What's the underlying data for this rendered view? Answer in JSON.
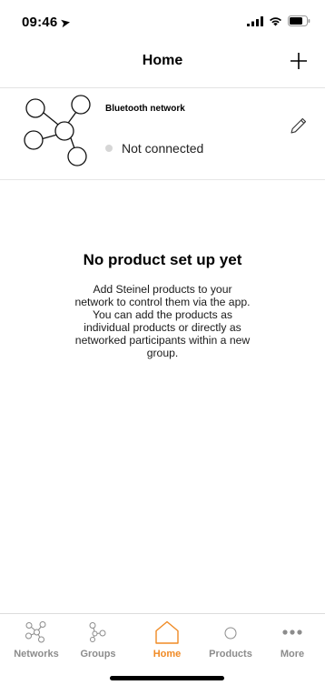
{
  "status_bar": {
    "time": "09:46",
    "location_icon": "location-arrow-icon",
    "icons": [
      "cellular-signal-icon",
      "wifi-icon",
      "battery-icon"
    ]
  },
  "nav": {
    "title": "Home",
    "add_icon": "plus-icon"
  },
  "network": {
    "name": "Bluetooth network",
    "status": "Not connected",
    "status_color": "#d6d6d6",
    "icon": "network-nodes-icon",
    "edit_icon": "pencil-icon"
  },
  "empty_state": {
    "title": "No product set up yet",
    "text": "Add Steinel products to your\nnetwork to control them via the app.\nYou can add the products as\nindividual products or directly as\nnetworked participants within a new\ngroup."
  },
  "tabs": [
    {
      "label": "Networks",
      "icon": "networks-icon",
      "active": false
    },
    {
      "label": "Groups",
      "icon": "groups-icon",
      "active": false
    },
    {
      "label": "Home",
      "icon": "home-icon",
      "active": true
    },
    {
      "label": "Products",
      "icon": "products-icon",
      "active": false
    },
    {
      "label": "More",
      "icon": "more-icon",
      "active": false
    }
  ],
  "colors": {
    "accent": "#f08a24",
    "inactive": "#8c8c8c"
  }
}
